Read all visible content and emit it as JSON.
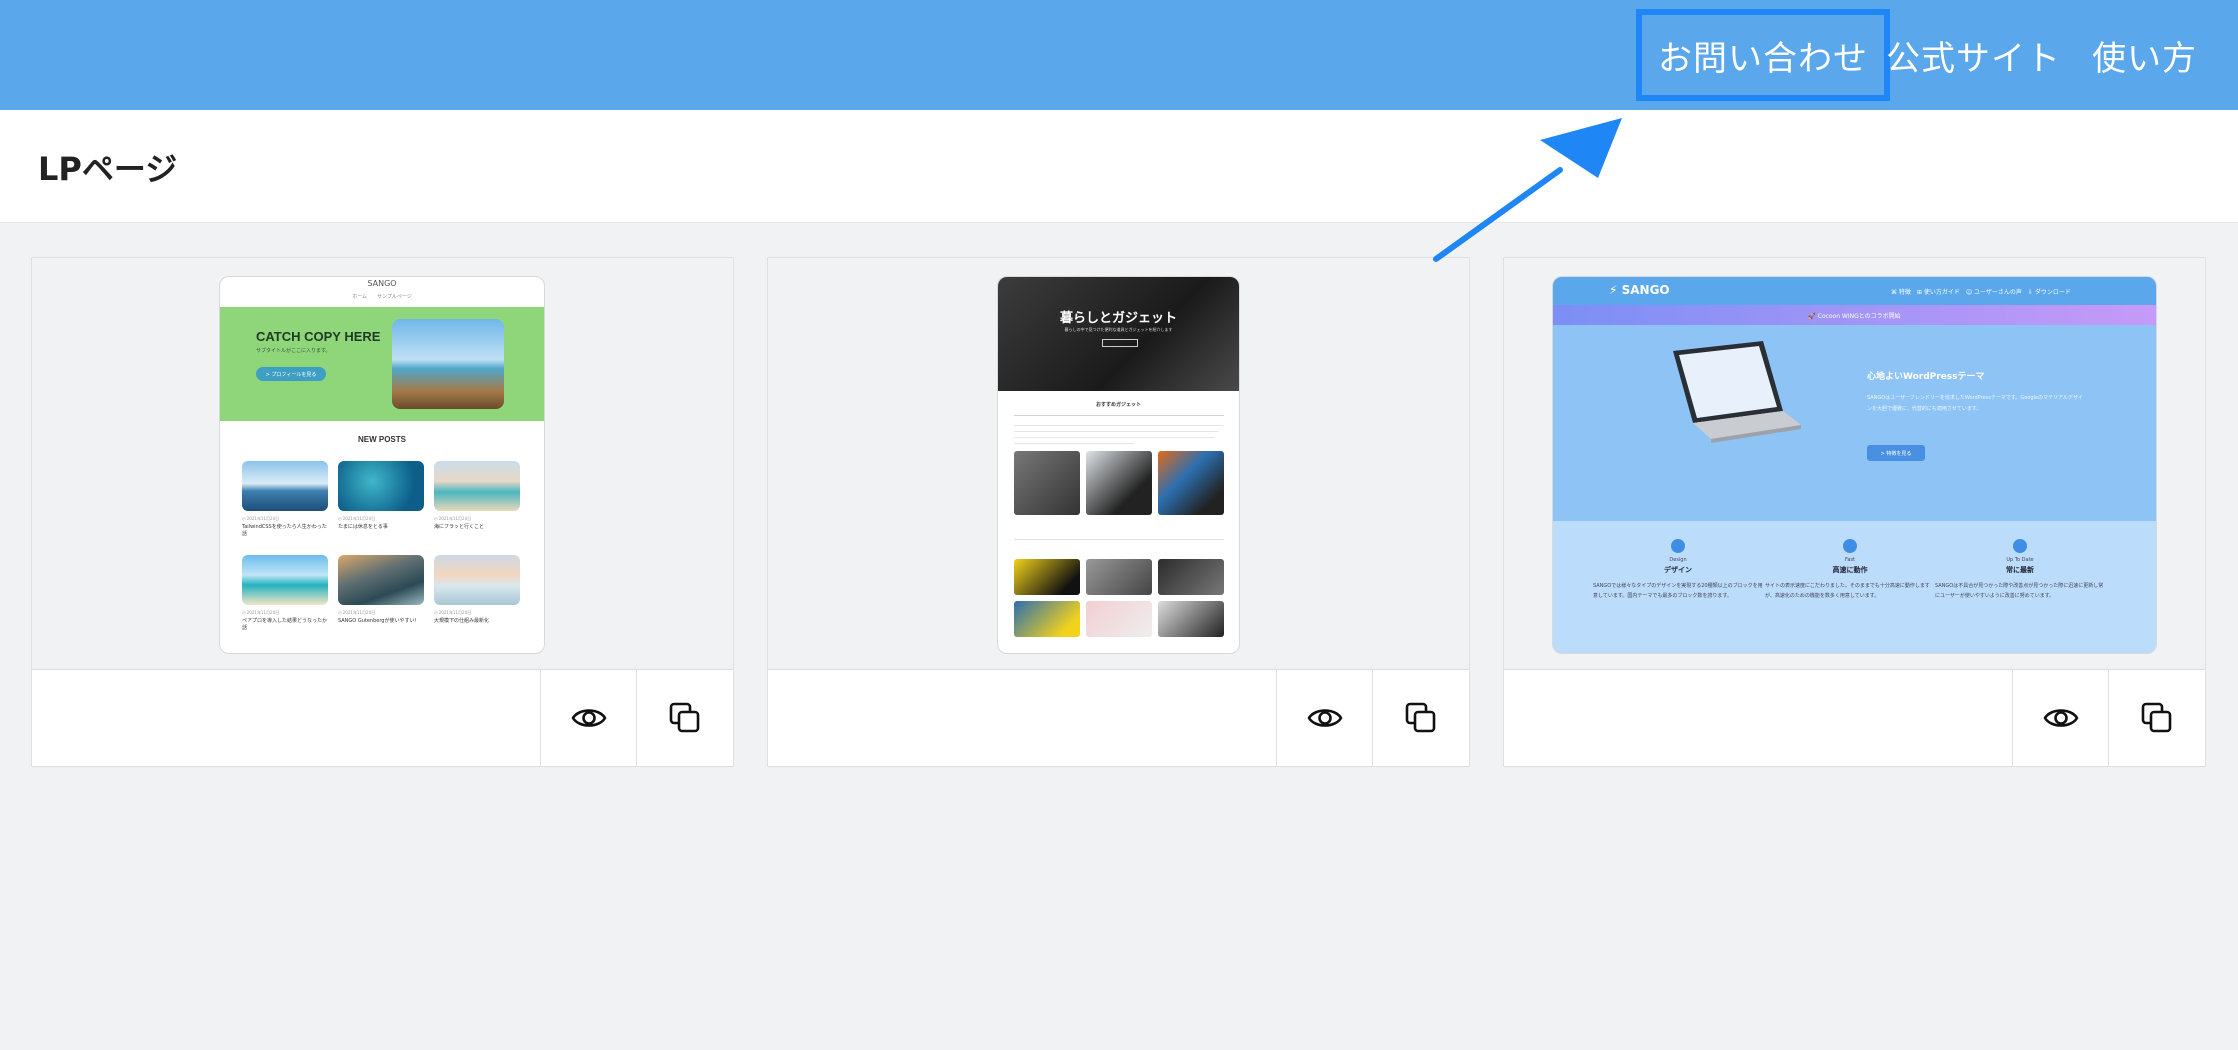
{
  "header": {
    "nav": [
      {
        "label": "お問い合わせ"
      },
      {
        "label": "公式サイト"
      },
      {
        "label": "使い方"
      }
    ]
  },
  "page": {
    "title": "LPページ"
  },
  "colors": {
    "header_bg": "#5aa7ec",
    "highlight": "#1e86f5",
    "page_bg": "#f1f2f4"
  },
  "cards": [
    {
      "preview": {
        "brand": "SANGO",
        "menu": "ホーム　　サンプルページ",
        "catch": "CATCH COPY HERE",
        "sub": "サブタイトルがここに入ります。",
        "button": "> プロフィールを見る",
        "section": "NEW POSTS",
        "posts": [
          {
            "date": "◷ 2021年11月24日",
            "title": "TailwindCSSを使ったら人生かわった話"
          },
          {
            "date": "◷ 2021年11月24日",
            "title": "たまには休息をとる事"
          },
          {
            "date": "◷ 2021年11月24日",
            "title": "海にフラッと行くこと"
          },
          {
            "date": "◷ 2021年11月24日",
            "title": "ペアプロを導入した結果どうなったか話"
          },
          {
            "date": "◷ 2021年11月24日",
            "title": "SANGO Gutenbergが使いやすい！"
          },
          {
            "date": "◷ 2021年11月24日",
            "title": "大規模下の仕組み最新化"
          }
        ]
      },
      "actions": {
        "view_icon": "eye-icon",
        "copy_icon": "copy-icon"
      }
    },
    {
      "preview": {
        "title": "暮らしとガジェット",
        "subtitle": "暮らしの中で見つけた便利な道具とガジェットを紹介します",
        "section": "おすすめガジェット"
      },
      "actions": {
        "view_icon": "eye-icon",
        "copy_icon": "copy-icon"
      }
    },
    {
      "preview": {
        "logo": "⚡ SANGO",
        "menu": "⌘ 特徴　⊞ 使い方ガイド　☺ ユーザーさんの声　⇩ ダウンロード",
        "banner": "🚀 Cocoon WINGとのコラボ開始",
        "title": "心地よいWordPressテーマ",
        "text": "SANGOはユーザーフレンドリーを追求したWordPressテーマです。Googleのマテリアルデザインを大胆で優雅に、代替的にも適用させています。",
        "button": "> 特徴を見る",
        "features": [
          {
            "en": "Design",
            "jp": "デザイン",
            "desc": "SANGOでは様々なタイプのデザインを実現する20種類以上のブロックを用意しています。国内テーマでも最多のブロック数を誇ります。"
          },
          {
            "en": "Fast",
            "jp": "高速に動作",
            "desc": "サイトの表示速度にこだわりました。そのままでも十分高速に動作しますが、高速化のための機能を数多く用意しています。"
          },
          {
            "en": "Up To Date",
            "jp": "常に最新",
            "desc": "SANGOは不具合が見つかった際や改善点が見つかった際に迅速に更新し常にユーザーが使いやすいように改善に努めています。"
          }
        ]
      },
      "actions": {
        "view_icon": "eye-icon",
        "copy_icon": "copy-icon"
      }
    }
  ]
}
